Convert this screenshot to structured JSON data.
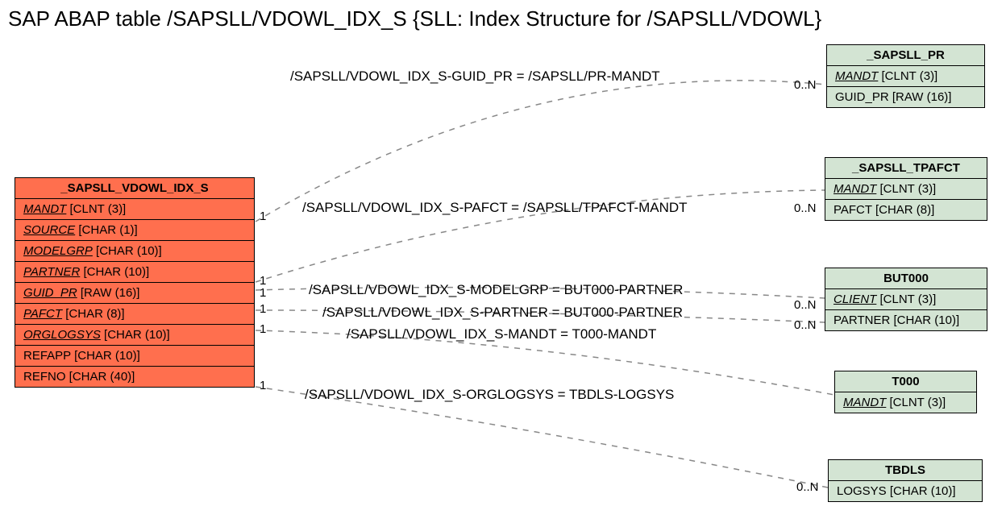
{
  "title": "SAP ABAP table /SAPSLL/VDOWL_IDX_S {SLL: Index Structure for /SAPSLL/VDOWL}",
  "main": {
    "name": "_SAPSLL_VDOWL_IDX_S",
    "fields": [
      {
        "name": "MANDT",
        "type": "[CLNT (3)]",
        "key": true
      },
      {
        "name": "SOURCE",
        "type": "[CHAR (1)]",
        "key": true
      },
      {
        "name": "MODELGRP",
        "type": "[CHAR (10)]",
        "key": true
      },
      {
        "name": "PARTNER",
        "type": "[CHAR (10)]",
        "key": true
      },
      {
        "name": "GUID_PR",
        "type": "[RAW (16)]",
        "key": true
      },
      {
        "name": "PAFCT",
        "type": "[CHAR (8)]",
        "key": true
      },
      {
        "name": "ORGLOGSYS",
        "type": "[CHAR (10)]",
        "key": true
      },
      {
        "name": "REFAPP",
        "type": "[CHAR (10)]",
        "key": false
      },
      {
        "name": "REFNO",
        "type": "[CHAR (40)]",
        "key": false
      }
    ]
  },
  "targets": [
    {
      "name": "_SAPSLL_PR",
      "fields": [
        {
          "name": "MANDT",
          "type": "[CLNT (3)]",
          "key": true
        },
        {
          "name": "GUID_PR",
          "type": "[RAW (16)]",
          "key": false
        }
      ]
    },
    {
      "name": "_SAPSLL_TPAFCT",
      "fields": [
        {
          "name": "MANDT",
          "type": "[CLNT (3)]",
          "key": true
        },
        {
          "name": "PAFCT",
          "type": "[CHAR (8)]",
          "key": false
        }
      ]
    },
    {
      "name": "BUT000",
      "fields": [
        {
          "name": "CLIENT",
          "type": "[CLNT (3)]",
          "key": true
        },
        {
          "name": "PARTNER",
          "type": "[CHAR (10)]",
          "key": false
        }
      ]
    },
    {
      "name": "T000",
      "fields": [
        {
          "name": "MANDT",
          "type": "[CLNT (3)]",
          "key": true
        }
      ]
    },
    {
      "name": "TBDLS",
      "fields": [
        {
          "name": "LOGSYS",
          "type": "[CHAR (10)]",
          "key": false
        }
      ]
    }
  ],
  "relations": [
    {
      "label": "/SAPSLL/VDOWL_IDX_S-GUID_PR = /SAPSLL/PR-MANDT",
      "left": "1",
      "right": "0..N"
    },
    {
      "label": "/SAPSLL/VDOWL_IDX_S-PAFCT = /SAPSLL/TPAFCT-MANDT",
      "left": "1",
      "right": "0..N"
    },
    {
      "label": "/SAPSLL/VDOWL_IDX_S-MODELGRP = BUT000-PARTNER",
      "left": "1",
      "right": "0..N"
    },
    {
      "label": "/SAPSLL/VDOWL_IDX_S-PARTNER = BUT000-PARTNER",
      "left": "1",
      "right": "0..N"
    },
    {
      "label": "/SAPSLL/VDOWL_IDX_S-MANDT = T000-MANDT",
      "left": "1",
      "right": ""
    },
    {
      "label": "/SAPSLL/VDOWL_IDX_S-ORGLOGSYS = TBDLS-LOGSYS",
      "left": "1",
      "right": "0..N"
    }
  ]
}
